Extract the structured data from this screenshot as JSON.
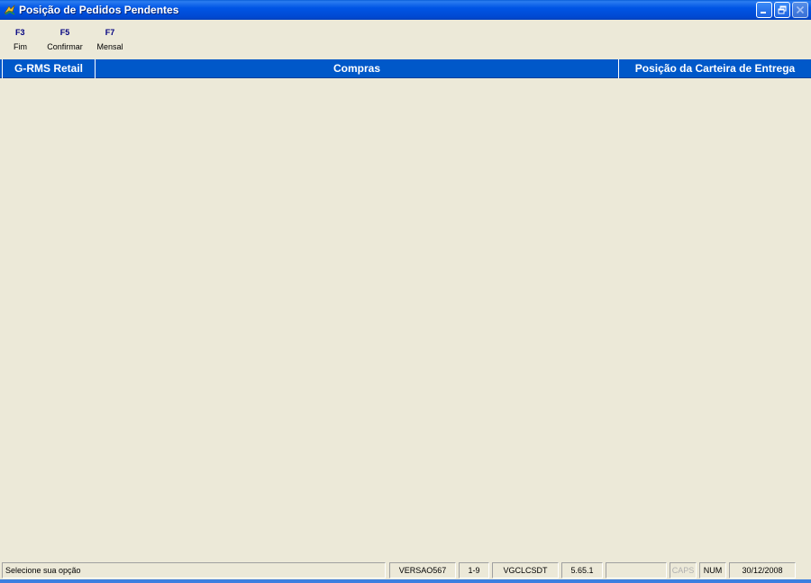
{
  "window": {
    "title": "Posição de Pedidos Pendentes"
  },
  "fkeys": [
    {
      "key": "F3",
      "label": "Fim"
    },
    {
      "key": "F5",
      "label": "Confirmar"
    },
    {
      "key": "F7",
      "label": "Mensal"
    }
  ],
  "header": {
    "left": "G-RMS Retail",
    "center": "Compras",
    "right": "Posição da Carteira de Entrega"
  },
  "status": {
    "message": "Selecione sua opção",
    "version": "VERSAO567",
    "range": "1-9",
    "program": "VGCLCSDT",
    "release": "5.65.1",
    "blank": "",
    "caps": "CAPS",
    "num": "NUM",
    "date": "30/12/2008"
  },
  "colors": {
    "titlebar": "#0055e5",
    "header": "#0058c9",
    "background": "#ece9d8",
    "fkey_key": "#000080"
  }
}
